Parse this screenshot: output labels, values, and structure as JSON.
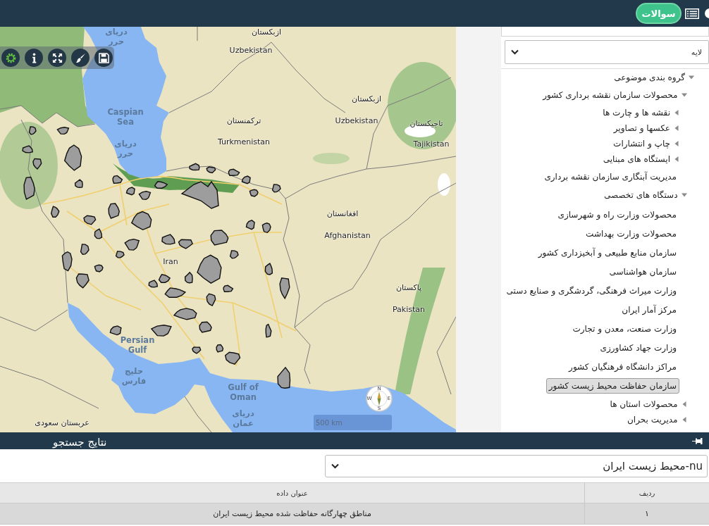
{
  "header": {
    "questions_button": "سوالات"
  },
  "map": {
    "labels": [
      {
        "kind": "country",
        "lines": [
          "ازبکستان"
        ]
      },
      {
        "kind": "sea",
        "lines": [
          "دریای",
          "حرر"
        ]
      },
      {
        "kind": "country",
        "lines": [
          "Uzbekistan"
        ]
      },
      {
        "kind": "country",
        "lines": [
          "ازبکستان"
        ]
      },
      {
        "kind": "country",
        "lines": [
          "تاجیکستان"
        ]
      },
      {
        "kind": "country",
        "lines": [
          "Uzbekistan"
        ]
      },
      {
        "kind": "country",
        "lines": [
          "ترکمنستان"
        ]
      },
      {
        "kind": "sea",
        "lines": [
          "Caspian",
          "Sea"
        ]
      },
      {
        "kind": "country",
        "lines": [
          "Tajikistan"
        ]
      },
      {
        "kind": "country",
        "lines": [
          "Turkmenistan"
        ]
      },
      {
        "kind": "sea",
        "lines": [
          "دریای",
          "حرر"
        ]
      },
      {
        "kind": "country",
        "lines": [
          "افغانستان"
        ]
      },
      {
        "kind": "country",
        "lines": [
          "Afghanistan"
        ]
      },
      {
        "kind": "country",
        "lines": [
          "Iran"
        ]
      },
      {
        "kind": "country",
        "lines": [
          "پاکستان"
        ]
      },
      {
        "kind": "country",
        "lines": [
          "Pakistan"
        ]
      },
      {
        "kind": "sea",
        "lines": [
          "Persian",
          "Gulf"
        ]
      },
      {
        "kind": "sea",
        "lines": [
          "حلیج",
          "فارس"
        ]
      },
      {
        "kind": "sea",
        "lines": [
          "Gulf of",
          "Oman"
        ]
      },
      {
        "kind": "sea",
        "lines": [
          "دریای",
          "عمان"
        ]
      },
      {
        "kind": "country",
        "lines": [
          "عربستان سعودی"
        ]
      }
    ],
    "compass": [
      "N",
      "E",
      "S",
      "W"
    ],
    "scale_bar": "500 km"
  },
  "layer_panel": {
    "layer_select": "لایه",
    "tree": [
      {
        "kind": "group",
        "label": "گروه بندی موضوعی",
        "expanded": true,
        "children": [
          {
            "kind": "group",
            "label": "محصولات سازمان نقشه برداری کشور",
            "expanded": true,
            "children": [
              {
                "kind": "group",
                "label": "نقشه ها و چارت ها",
                "expanded": false
              },
              {
                "kind": "group",
                "label": "عکسها و تصاویر",
                "expanded": false
              },
              {
                "kind": "group",
                "label": "چاپ و انتشارات",
                "expanded": false
              },
              {
                "kind": "group",
                "label": "ایستگاه های مبنایی",
                "expanded": false
              },
              {
                "kind": "layer",
                "label": "مدیریت آبنگاری سازمان نقشه برداری",
                "selected": false
              }
            ]
          },
          {
            "kind": "group",
            "label": "دستگاه های تخصصی",
            "expanded": true,
            "children": [
              {
                "kind": "layer",
                "label": "محصولات وزارت راه و شهرسازی",
                "selected": false
              },
              {
                "kind": "layer",
                "label": "محصولات وزارت بهداشت",
                "selected": false
              },
              {
                "kind": "layer",
                "label": "سازمان منابع طبیعی و آبخیزداری کشور",
                "selected": false
              },
              {
                "kind": "layer",
                "label": "سازمان هواشناسی",
                "selected": false
              },
              {
                "kind": "layer",
                "label": "وزارت میراث فرهنگی، گردشگری و صنایع دستی",
                "selected": false
              },
              {
                "kind": "layer",
                "label": "مرکز آمار ایران",
                "selected": false
              },
              {
                "kind": "layer",
                "label": "وزارت صنعت، معدن و تجارت",
                "selected": false
              },
              {
                "kind": "layer",
                "label": "وزارت جهاد کشاورزی",
                "selected": false
              },
              {
                "kind": "layer",
                "label": "مراکز دانشگاه فرهنگیان کشور",
                "selected": false
              },
              {
                "kind": "layer",
                "label": "سازمان حفاظت محیط زیست کشور",
                "selected": true
              }
            ]
          },
          {
            "kind": "group",
            "label": "محصولات استان ها",
            "expanded": false
          },
          {
            "kind": "group",
            "label": "مدیریت بحران",
            "expanded": false
          }
        ]
      }
    ]
  },
  "results": {
    "title": "نتایج جستجو",
    "dataset_select": "nu-محیط زیست ایران",
    "table": {
      "columns": [
        "ردیف",
        "عنوان داده"
      ],
      "rows": [
        {
          "cells": [
            "۱",
            "مناطق چهارگانه حفاظت شده محیط زیست ایران"
          ],
          "selected": true
        }
      ]
    }
  }
}
